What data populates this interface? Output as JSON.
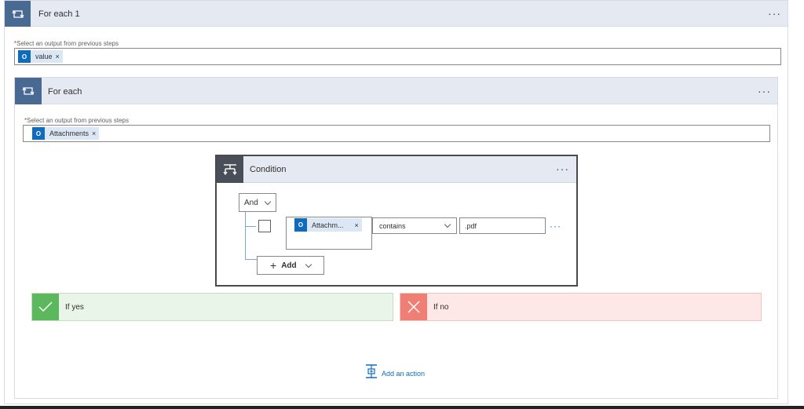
{
  "outer_loop": {
    "title": "For each 1",
    "more": "···",
    "field_label": "Select an output from previous steps",
    "required_mark": "*",
    "token": {
      "icon": "outlook-icon",
      "icon_glyph": "O",
      "label": "value",
      "remove": "×"
    }
  },
  "inner_loop": {
    "title": "For each",
    "more": "···",
    "field_label": "Select an output from previous steps",
    "required_mark": "*",
    "token": {
      "icon": "outlook-icon",
      "icon_glyph": "O",
      "label": "Attachments",
      "remove": "×"
    }
  },
  "condition": {
    "title": "Condition",
    "more": "···",
    "group_operator": "And",
    "row": {
      "token": {
        "icon": "outlook-icon",
        "icon_glyph": "O",
        "label": "Attachm...",
        "remove": "×"
      },
      "operator": "contains",
      "value": ".pdf",
      "more": "···"
    },
    "add_label": "Add"
  },
  "branches": {
    "yes": {
      "label": "If yes",
      "icon": "check-icon"
    },
    "no": {
      "label": "If no",
      "icon": "close-icon"
    }
  },
  "add_action": {
    "label": "Add an action",
    "icon": "add-action-icon"
  },
  "colors": {
    "header_bg": "#e5e9f2",
    "loop_icon_bg": "#486991",
    "condition_icon_bg": "#484f58",
    "yes_bg": "#e9f5e9",
    "yes_icon": "#5cb85c",
    "no_bg": "#fde7e7",
    "no_icon": "#ef7f74",
    "link": "#0f6cbd",
    "token_bg": "#dbe7f4",
    "token_icon": "#0f6cbd"
  }
}
